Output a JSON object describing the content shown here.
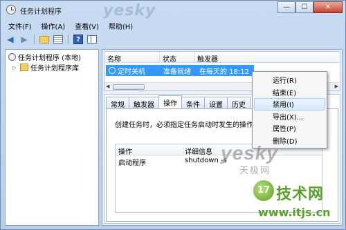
{
  "window": {
    "title": "任务计划程序",
    "watermark": "yesky"
  },
  "window_buttons": {
    "minimize": "—",
    "maximize": "☐",
    "close": "✕"
  },
  "menu": [
    "文件(F)",
    "操作(A)",
    "查看(V)",
    "帮助(H)"
  ],
  "tree": {
    "root": "任务计划程序 (本地)",
    "child": "任务计划程序库"
  },
  "task_list": {
    "columns": [
      "名称",
      "状态",
      "触发器"
    ],
    "rows": [
      {
        "name": "定时关机",
        "status": "准备就绪",
        "trigger": "在每天的 18:12"
      }
    ]
  },
  "tabs": [
    "常规",
    "触发器",
    "操作",
    "条件",
    "设置",
    "历史"
  ],
  "active_tab": "操作",
  "action_tab": {
    "description": "创建任务时，必须指定任务启动时发生的操作。",
    "columns": [
      "操作",
      "详细信息"
    ],
    "rows": [
      {
        "action": "启动程序",
        "detail": "shutdown -s"
      }
    ]
  },
  "context_menu": {
    "items": [
      "运行(R)",
      "结束(E)",
      "禁用(I)",
      "导出(X)...",
      "属性(P)",
      "删除(D)"
    ],
    "hovered": "禁用(I)"
  },
  "watermarks": {
    "yesky": "yesky",
    "yesky_cn": "天极网",
    "logo_number": "17",
    "brand": "技术网",
    "url": "www.itjs.cn"
  }
}
